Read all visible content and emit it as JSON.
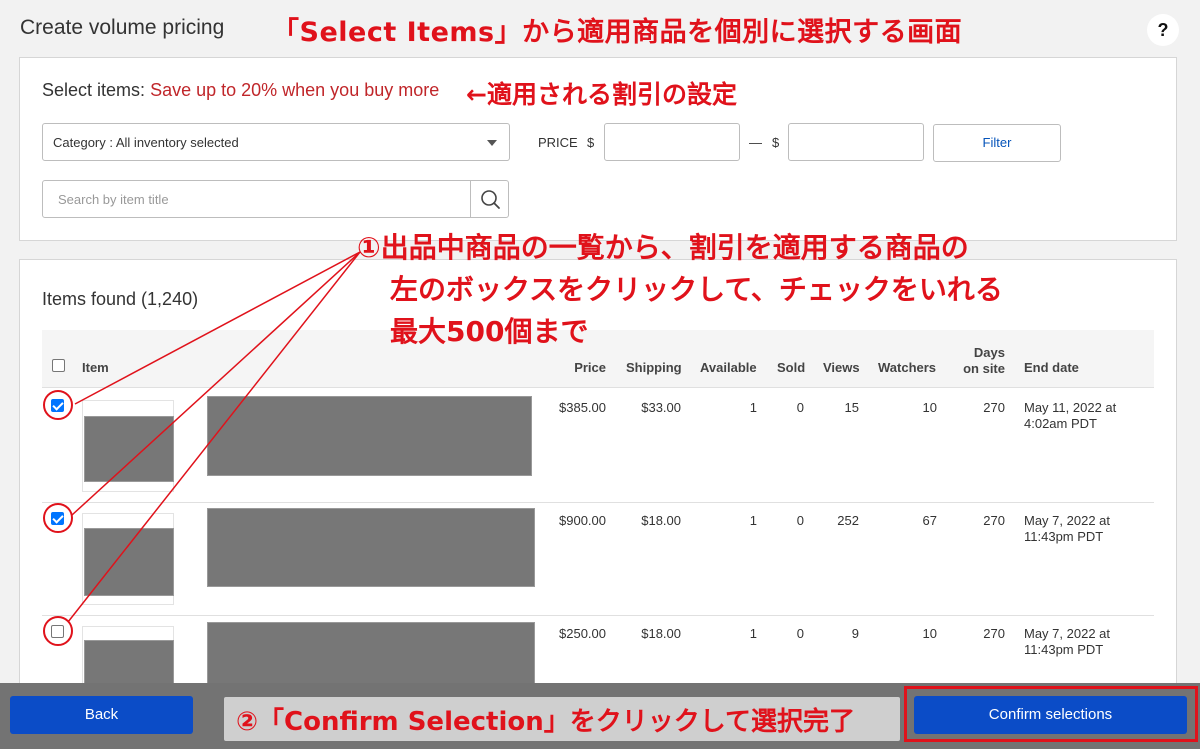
{
  "header": {
    "title": "Create volume pricing",
    "help_label": "?",
    "annotation": "「Select Items」から適用商品を個別に選択する画面"
  },
  "filter_panel": {
    "select_label": "Select items:",
    "select_value": "Save up to 20% when you buy more",
    "annotation": "←適用される割引の設定",
    "category_select": "Category : All inventory selected",
    "price_label": "PRICE",
    "currency": "$",
    "price_dash": "—",
    "filter_button": "Filter",
    "search_placeholder": "Search by item title"
  },
  "items_panel": {
    "items_found": "Items found (1,240)",
    "annotation_lines": [
      "①出品中商品の一覧から、割引を適用する商品の",
      "左のボックスをクリックして、チェックをいれる",
      "最大500個まで"
    ],
    "columns": {
      "item": "Item",
      "price": "Price",
      "shipping": "Shipping",
      "available": "Available",
      "sold": "Sold",
      "views": "Views",
      "watchers": "Watchers",
      "days_line1": "Days",
      "days_line2": "on site",
      "end_date": "End date"
    },
    "rows": [
      {
        "checked": true,
        "price": "$385.00",
        "shipping": "$33.00",
        "available": "1",
        "sold": "0",
        "views": "15",
        "watchers": "10",
        "days": "270",
        "end_date_1": "May 11, 2022 at",
        "end_date_2": "4:02am PDT"
      },
      {
        "checked": true,
        "price": "$900.00",
        "shipping": "$18.00",
        "available": "1",
        "sold": "0",
        "views": "252",
        "watchers": "67",
        "days": "270",
        "end_date_1": "May 7, 2022 at",
        "end_date_2": "11:43pm PDT"
      },
      {
        "checked": false,
        "price": "$250.00",
        "shipping": "$18.00",
        "available": "1",
        "sold": "0",
        "views": "9",
        "watchers": "10",
        "days": "270",
        "end_date_1": "May 7, 2022 at",
        "end_date_2": "11:43pm PDT"
      }
    ]
  },
  "footer": {
    "back_button": "Back",
    "annotation": "②「Confirm Selection」をクリックして選択完了",
    "confirm_button": "Confirm selections"
  },
  "colors": {
    "annotation_red": "#e0121b",
    "primary_blue": "#0b4cc7",
    "checkbox_blue": "#0075ff"
  }
}
